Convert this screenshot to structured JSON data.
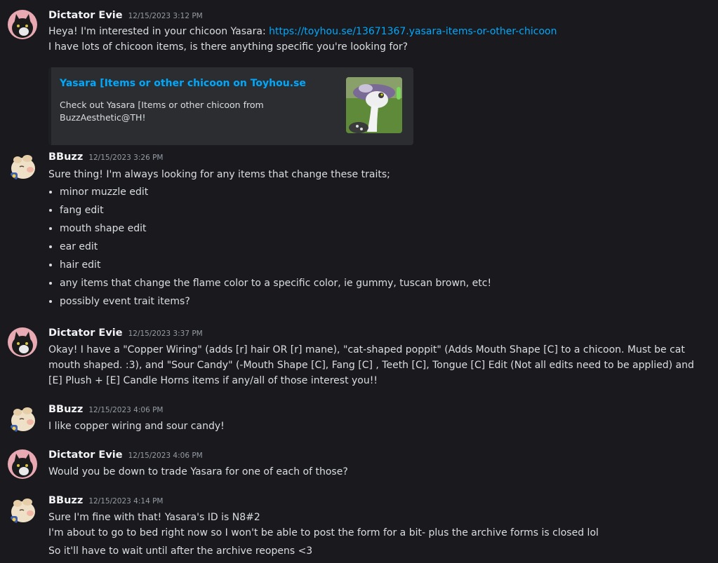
{
  "messages": [
    {
      "author": "Dictator Evie",
      "timestamp": "12/15/2023 3:12 PM",
      "line1_prefix": "Heya! I'm interested in your chicoon Yasara: ",
      "link": "https://toyhou.se/13671367.yasara-items-or-other-chicoon",
      "line2": "I have lots of chicoon items, is there anything specific you're looking for?",
      "embed": {
        "title": "Yasara [Items or other chicoon on Toyhou.se",
        "description": "Check out Yasara [Items or other chicoon from BuzzAesthetic@TH!"
      }
    },
    {
      "author": "BBuzz",
      "timestamp": "12/15/2023 3:26 PM",
      "text": "Sure thing! I'm always looking for any items that change these traits;",
      "items": [
        "minor muzzle edit",
        "fang edit",
        "mouth shape edit",
        "ear edit",
        "hair edit",
        "any items that change the flame color to a specific color, ie gummy, tuscan brown, etc!",
        "possibly event trait items?"
      ]
    },
    {
      "author": "Dictator Evie",
      "timestamp": "12/15/2023 3:37 PM",
      "text": "Okay! I have a \"Copper Wiring\" (adds [r] hair OR [r] mane), \"cat-shaped poppit\" (Adds Mouth Shape [C] to a chicoon. Must be cat mouth shaped. :3), and \"Sour Candy\" (-Mouth Shape [C], Fang [C] , Teeth [C], Tongue [C] Edit (Not all edits need to be applied) and [E] Plush + [E] Candle Horns items if any/all of those interest you!!"
    },
    {
      "author": "BBuzz",
      "timestamp": "12/15/2023 4:06 PM",
      "text": "I like copper wiring and sour candy!"
    },
    {
      "author": "Dictator Evie",
      "timestamp": "12/15/2023 4:06 PM",
      "text": "Would you be down to trade Yasara for one of each of those?"
    },
    {
      "author": "BBuzz",
      "timestamp": "12/15/2023 4:14 PM",
      "lines": [
        "Sure I'm fine with that! Yasara's ID is N8#2",
        "I'm about to go to bed right now so I won't be able to post the form for a bit- plus the archive forms is closed lol",
        "So it'll have to wait until after the archive reopens <3"
      ]
    }
  ],
  "colors": {
    "background": "#1a1a1e",
    "link": "#00a8fc",
    "author": "#f2f3f5",
    "timestamp": "#949ba4",
    "text": "#dbdee1",
    "embed_bg": "#2b2d31"
  },
  "icons": {
    "evie_avatar": "black-cat-avatar-icon",
    "bbuzz_avatar": "cream-creature-avatar-icon",
    "embed_thumbnail": "chicoon-creature-thumbnail"
  }
}
